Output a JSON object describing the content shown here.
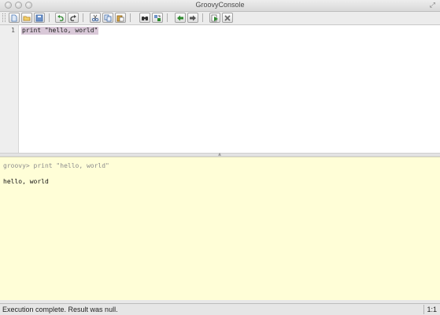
{
  "window": {
    "title": "GroovyConsole"
  },
  "toolbar": {
    "buttons": [
      {
        "name": "new-file-button",
        "icon": "new-document-icon",
        "color": "#4a78b5"
      },
      {
        "name": "open-file-button",
        "icon": "open-folder-icon",
        "color": "#d9a431"
      },
      {
        "name": "save-file-button",
        "icon": "save-disk-icon",
        "color": "#3f6aa8"
      },
      {
        "name": "undo-button",
        "icon": "undo-arrow-icon",
        "color": "#2f8a2f"
      },
      {
        "name": "redo-button",
        "icon": "redo-arrow-icon",
        "color": "#444444"
      },
      {
        "name": "cut-button",
        "icon": "scissors-icon",
        "color": "#3f6aa8"
      },
      {
        "name": "copy-button",
        "icon": "copy-icon",
        "color": "#3f6aa8"
      },
      {
        "name": "paste-button",
        "icon": "paste-clipboard-icon",
        "color": "#b07a24"
      },
      {
        "name": "find-button",
        "icon": "binoculars-icon",
        "color": "#333333"
      },
      {
        "name": "replace-button",
        "icon": "find-replace-icon",
        "color": "#3f6aa8"
      },
      {
        "name": "history-previous-button",
        "icon": "history-back-icon",
        "color": "#2f8a2f"
      },
      {
        "name": "history-next-button",
        "icon": "history-forward-icon",
        "color": "#555555"
      },
      {
        "name": "run-script-button",
        "icon": "run-script-icon",
        "color": "#2f8a2f"
      },
      {
        "name": "interrupt-script-button",
        "icon": "stop-x-icon",
        "color": "#666666"
      }
    ]
  },
  "editor": {
    "line_number": "1",
    "code": "print \"hello, world\""
  },
  "output": {
    "command_echo": "groovy> print \"hello, world\"",
    "result": "hello, world"
  },
  "status": {
    "message": "Execution complete. Result was null.",
    "caret_position": "1:1"
  }
}
